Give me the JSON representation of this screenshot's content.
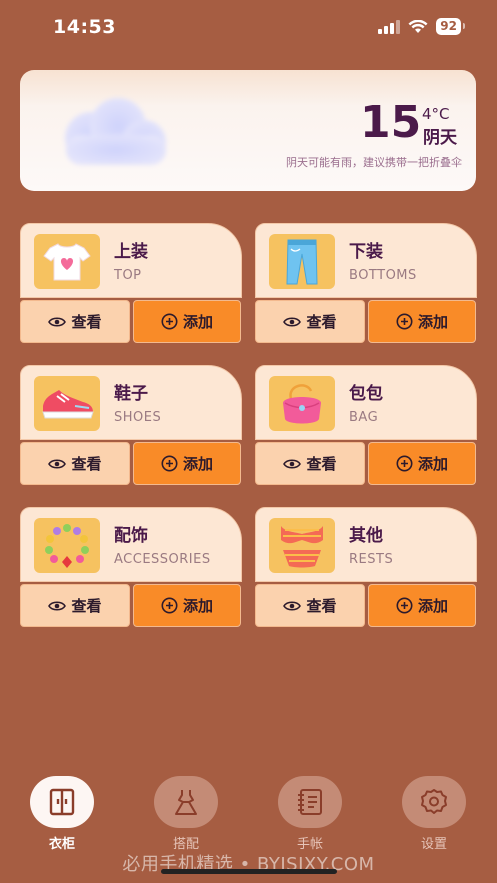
{
  "status_bar": {
    "time": "14:53",
    "battery": "92"
  },
  "weather": {
    "temperature": "15",
    "unit": "4°C",
    "description": "阴天",
    "tip": "阴天可能有雨，建议携带一把折叠伞",
    "icon": "cloud-icon"
  },
  "categories": [
    {
      "title": "上装",
      "subtitle": "TOP",
      "icon": "t-shirt-icon",
      "view_label": "查看",
      "add_label": "添加"
    },
    {
      "title": "下装",
      "subtitle": "BOTTOMS",
      "icon": "jeans-icon",
      "view_label": "查看",
      "add_label": "添加"
    },
    {
      "title": "鞋子",
      "subtitle": "SHOES",
      "icon": "sneaker-icon",
      "view_label": "查看",
      "add_label": "添加"
    },
    {
      "title": "包包",
      "subtitle": "BAG",
      "icon": "handbag-icon",
      "view_label": "查看",
      "add_label": "添加"
    },
    {
      "title": "配饰",
      "subtitle": "ACCESSORIES",
      "icon": "necklace-icon",
      "view_label": "查看",
      "add_label": "添加"
    },
    {
      "title": "其他",
      "subtitle": "RESTS",
      "icon": "bikini-icon",
      "view_label": "查看",
      "add_label": "添加"
    }
  ],
  "nav": [
    {
      "label": "衣柜",
      "icon": "wardrobe-icon",
      "active": true
    },
    {
      "label": "搭配",
      "icon": "dress-icon",
      "active": false
    },
    {
      "label": "手帐",
      "icon": "notebook-icon",
      "active": false
    },
    {
      "label": "设置",
      "icon": "gear-icon",
      "active": false
    }
  ],
  "watermark": "必用手机精选 • BYJSJXY.COM",
  "colors": {
    "background": "#a65d42",
    "add_button": "#f98b28",
    "view_button": "#fbd2ae",
    "card": "#fde7d4"
  }
}
